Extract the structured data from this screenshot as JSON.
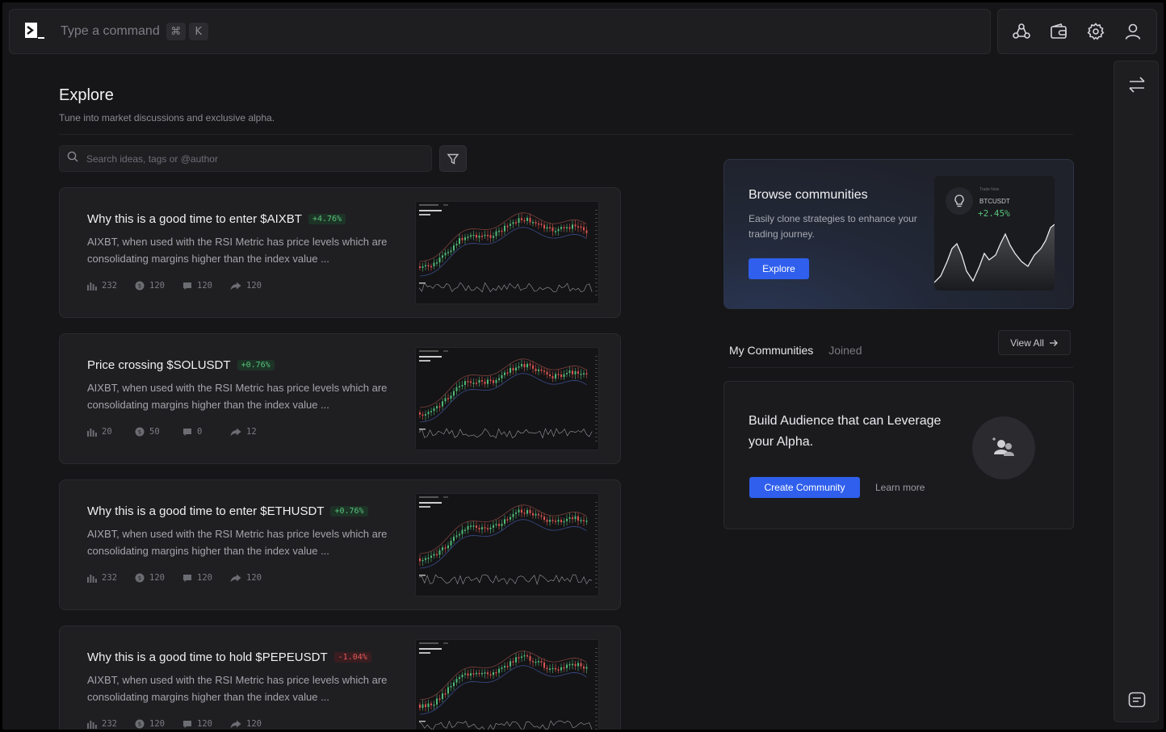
{
  "command_bar": {
    "placeholder": "Type a command",
    "shortcut_keys": [
      "⌘",
      "K"
    ]
  },
  "header": {
    "title": "Explore",
    "subtitle": "Tune into market discussions and exclusive alpha."
  },
  "search": {
    "placeholder": "Search ideas, tags or @author"
  },
  "ideas": [
    {
      "title": "Why this is a good time to enter $AIXBT",
      "change": "+4.76%",
      "direction": "up",
      "description": "AIXBT, when used with the RSI Metric has price levels which are consolidating margins higher than the index value ...",
      "views": "232",
      "coins": "120",
      "comments": "120",
      "shares": "120"
    },
    {
      "title": "Price crossing $SOLUSDT",
      "change": "+0.76%",
      "direction": "up",
      "description": "AIXBT, when used with the RSI Metric has price levels which are consolidating margins higher than the index value ...",
      "views": "20",
      "coins": "50",
      "comments": "0",
      "shares": "12"
    },
    {
      "title": "Why this is a good time to enter $ETHUSDT",
      "change": "+0.76%",
      "direction": "up",
      "description": "AIXBT, when used with the RSI Metric has price levels which are consolidating margins higher than the index value ...",
      "views": "232",
      "coins": "120",
      "comments": "120",
      "shares": "120"
    },
    {
      "title": "Why this is a good time to hold $PEPEUSDT",
      "change": "-1.04%",
      "direction": "down",
      "description": "AIXBT, when used with the RSI Metric has price levels which are consolidating margins higher than the index value ...",
      "views": "232",
      "coins": "120",
      "comments": "120",
      "shares": "120"
    }
  ],
  "browse": {
    "title": "Browse communities",
    "description": "Easily clone strategies to enhance your trading journey.",
    "button": "Explore",
    "mini_card": {
      "label": "Trade Now",
      "symbol": "BTCUSDT",
      "change": "+2.45%"
    }
  },
  "communities": {
    "tabs": [
      "My Communities",
      "Joined"
    ],
    "active_tab": "My Communities",
    "view_all": "View All"
  },
  "build": {
    "title": "Build Audience that can Leverage your Alpha.",
    "primary_button": "Create Community",
    "secondary_link": "Learn more"
  },
  "colors": {
    "accent": "#2f5fec",
    "positive": "#57c27a",
    "negative": "#e35a5a",
    "background": "#161618",
    "surface": "#1f1f22"
  },
  "icons": {
    "top_bar": [
      "community-icon",
      "wallet-icon",
      "settings-icon",
      "profile-icon"
    ],
    "rail": [
      "swap-icon",
      "chat-icon"
    ]
  }
}
